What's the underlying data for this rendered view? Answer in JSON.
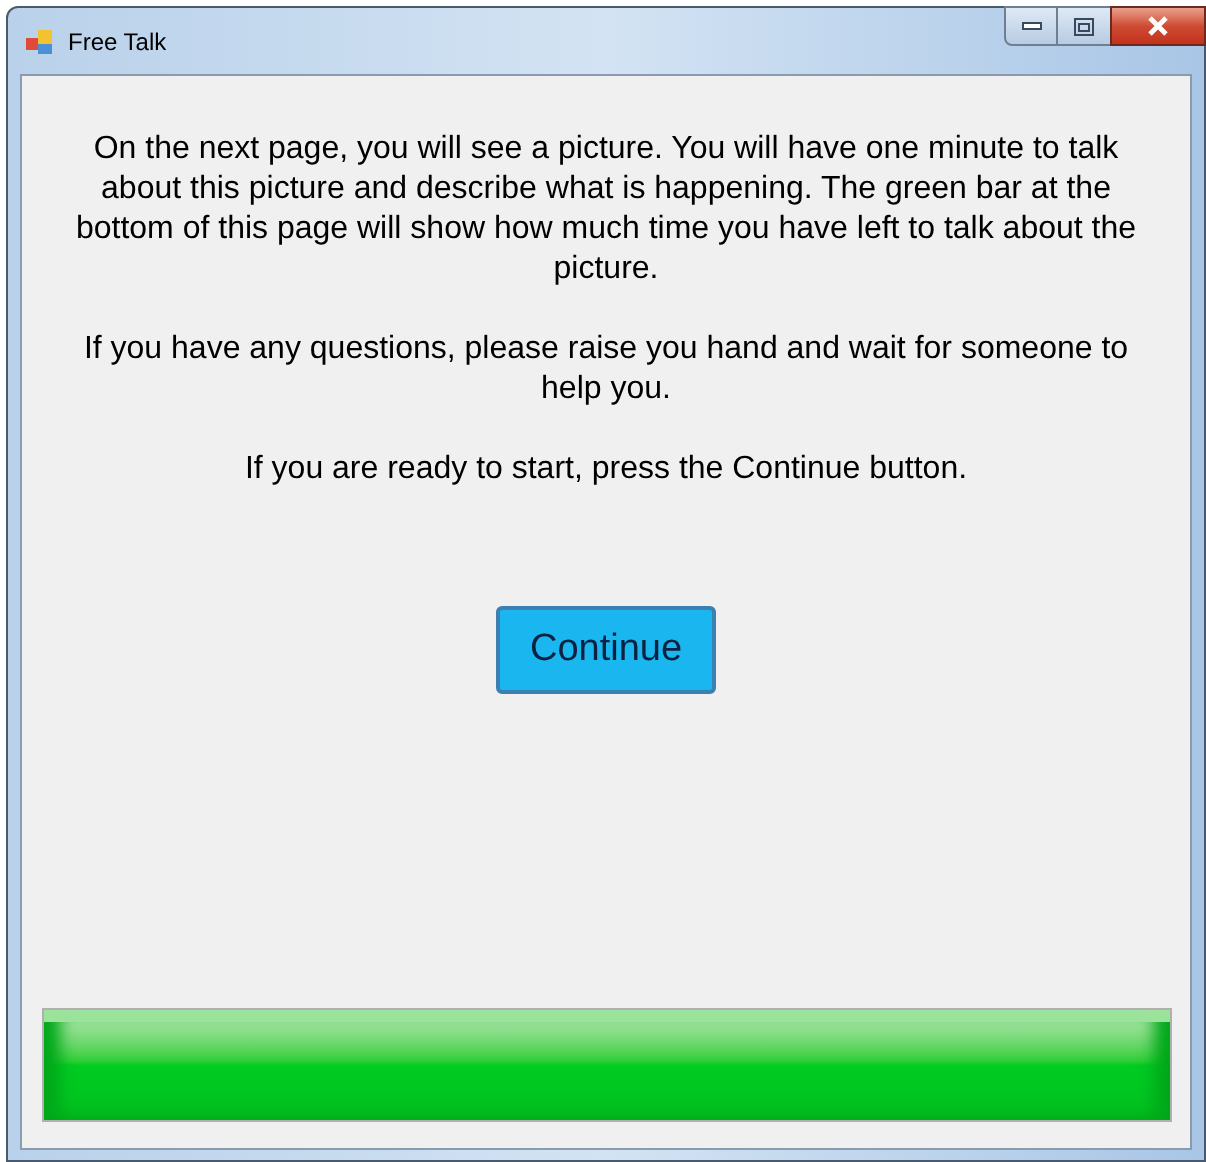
{
  "window": {
    "title": "Free Talk"
  },
  "paragraphs": [
    "On the next page, you will see a picture. You will have one minute to talk about this picture and describe what is happening. The green bar at the bottom of this page will show how much time you have left to talk about the picture.",
    "If you have any questions, please raise you hand and wait for someone to help you.",
    "If you are ready to start, press the Continue button."
  ],
  "continue_button": {
    "label": "Continue"
  },
  "time_bar": {
    "level": 1
  }
}
